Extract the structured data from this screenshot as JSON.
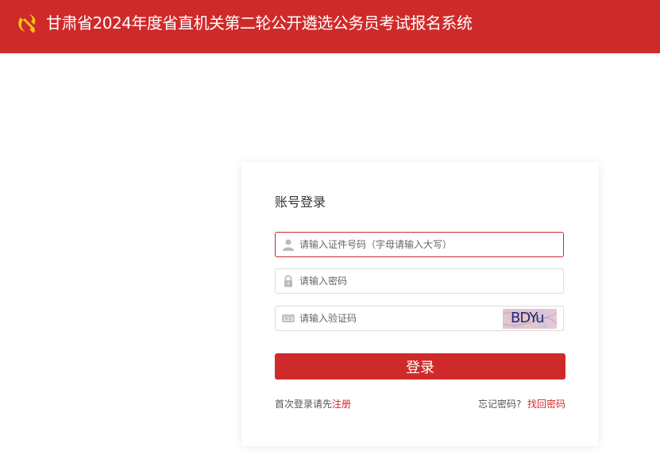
{
  "header": {
    "title": "甘肃省2024年度省直机关第二轮公开遴选公务员考试报名系统",
    "background_color": "#cf2a2a",
    "logo_icon": "party-emblem-icon"
  },
  "login": {
    "title": "账号登录",
    "id_field": {
      "placeholder": "请输入证件号码（字母请输入大写）",
      "value": "",
      "icon": "user-icon"
    },
    "password_field": {
      "placeholder": "请输入密码",
      "value": "",
      "icon": "lock-icon"
    },
    "captcha_field": {
      "placeholder": "请输入验证码",
      "value": "",
      "icon": "number-123-icon",
      "captcha_text": "BDYu"
    },
    "submit_label": "登录",
    "register_prompt": "首次登录请先",
    "register_link": "注册",
    "forgot_prompt": "忘记密码?",
    "recover_link": "找回密码"
  },
  "colors": {
    "accent": "#cf2a2a",
    "border": "#dcdcdc",
    "text": "#333333"
  }
}
